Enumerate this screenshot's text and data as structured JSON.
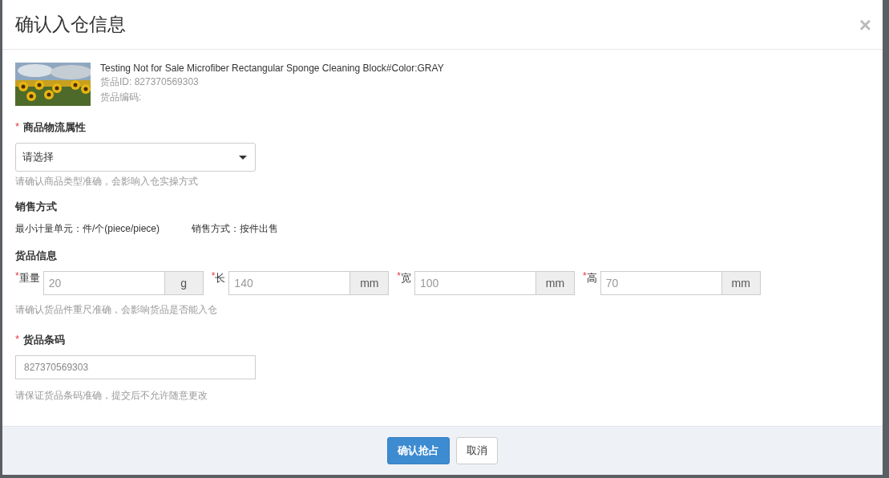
{
  "dialog": {
    "title": "确认入仓信息",
    "close": "×"
  },
  "product": {
    "name": "Testing Not for Sale Microfiber Rectangular Sponge Cleaning Block#Color:GRAY",
    "id_line": "货品ID: 827370569303",
    "code_line": "货品编码:"
  },
  "logistics": {
    "label": "商品物流属性",
    "mark": "*",
    "select": {
      "value": "请选择"
    },
    "hint": "请确认商品类型准确，会影响入仓实操方式"
  },
  "sales": {
    "label": "销售方式",
    "items": [
      "最小计量单元：件/个(piece/piece)",
      "销售方式：按件出售"
    ]
  },
  "goods_info": {
    "label": "货品信息",
    "fields": [
      {
        "mark": "*",
        "label": "重量",
        "placeholder": "20",
        "unit": "g"
      },
      {
        "mark": "*",
        "label": "长",
        "placeholder": "140",
        "unit": "mm"
      },
      {
        "mark": "*",
        "label": "宽",
        "placeholder": "100",
        "unit": "mm"
      },
      {
        "mark": "*",
        "label": "高",
        "placeholder": "70",
        "unit": "mm"
      }
    ],
    "hint": "请确认货品件重尺准确，会影响货品是否能入仓"
  },
  "barcode": {
    "label": "货品条码",
    "mark": "*",
    "placeholder": "827370569303",
    "hint": "请保证货品条码准确，提交后不允许随意更改"
  },
  "buttons": [
    {
      "label": "确认抢占",
      "kind": "primary"
    },
    {
      "label": "取消",
      "kind": "default"
    }
  ]
}
